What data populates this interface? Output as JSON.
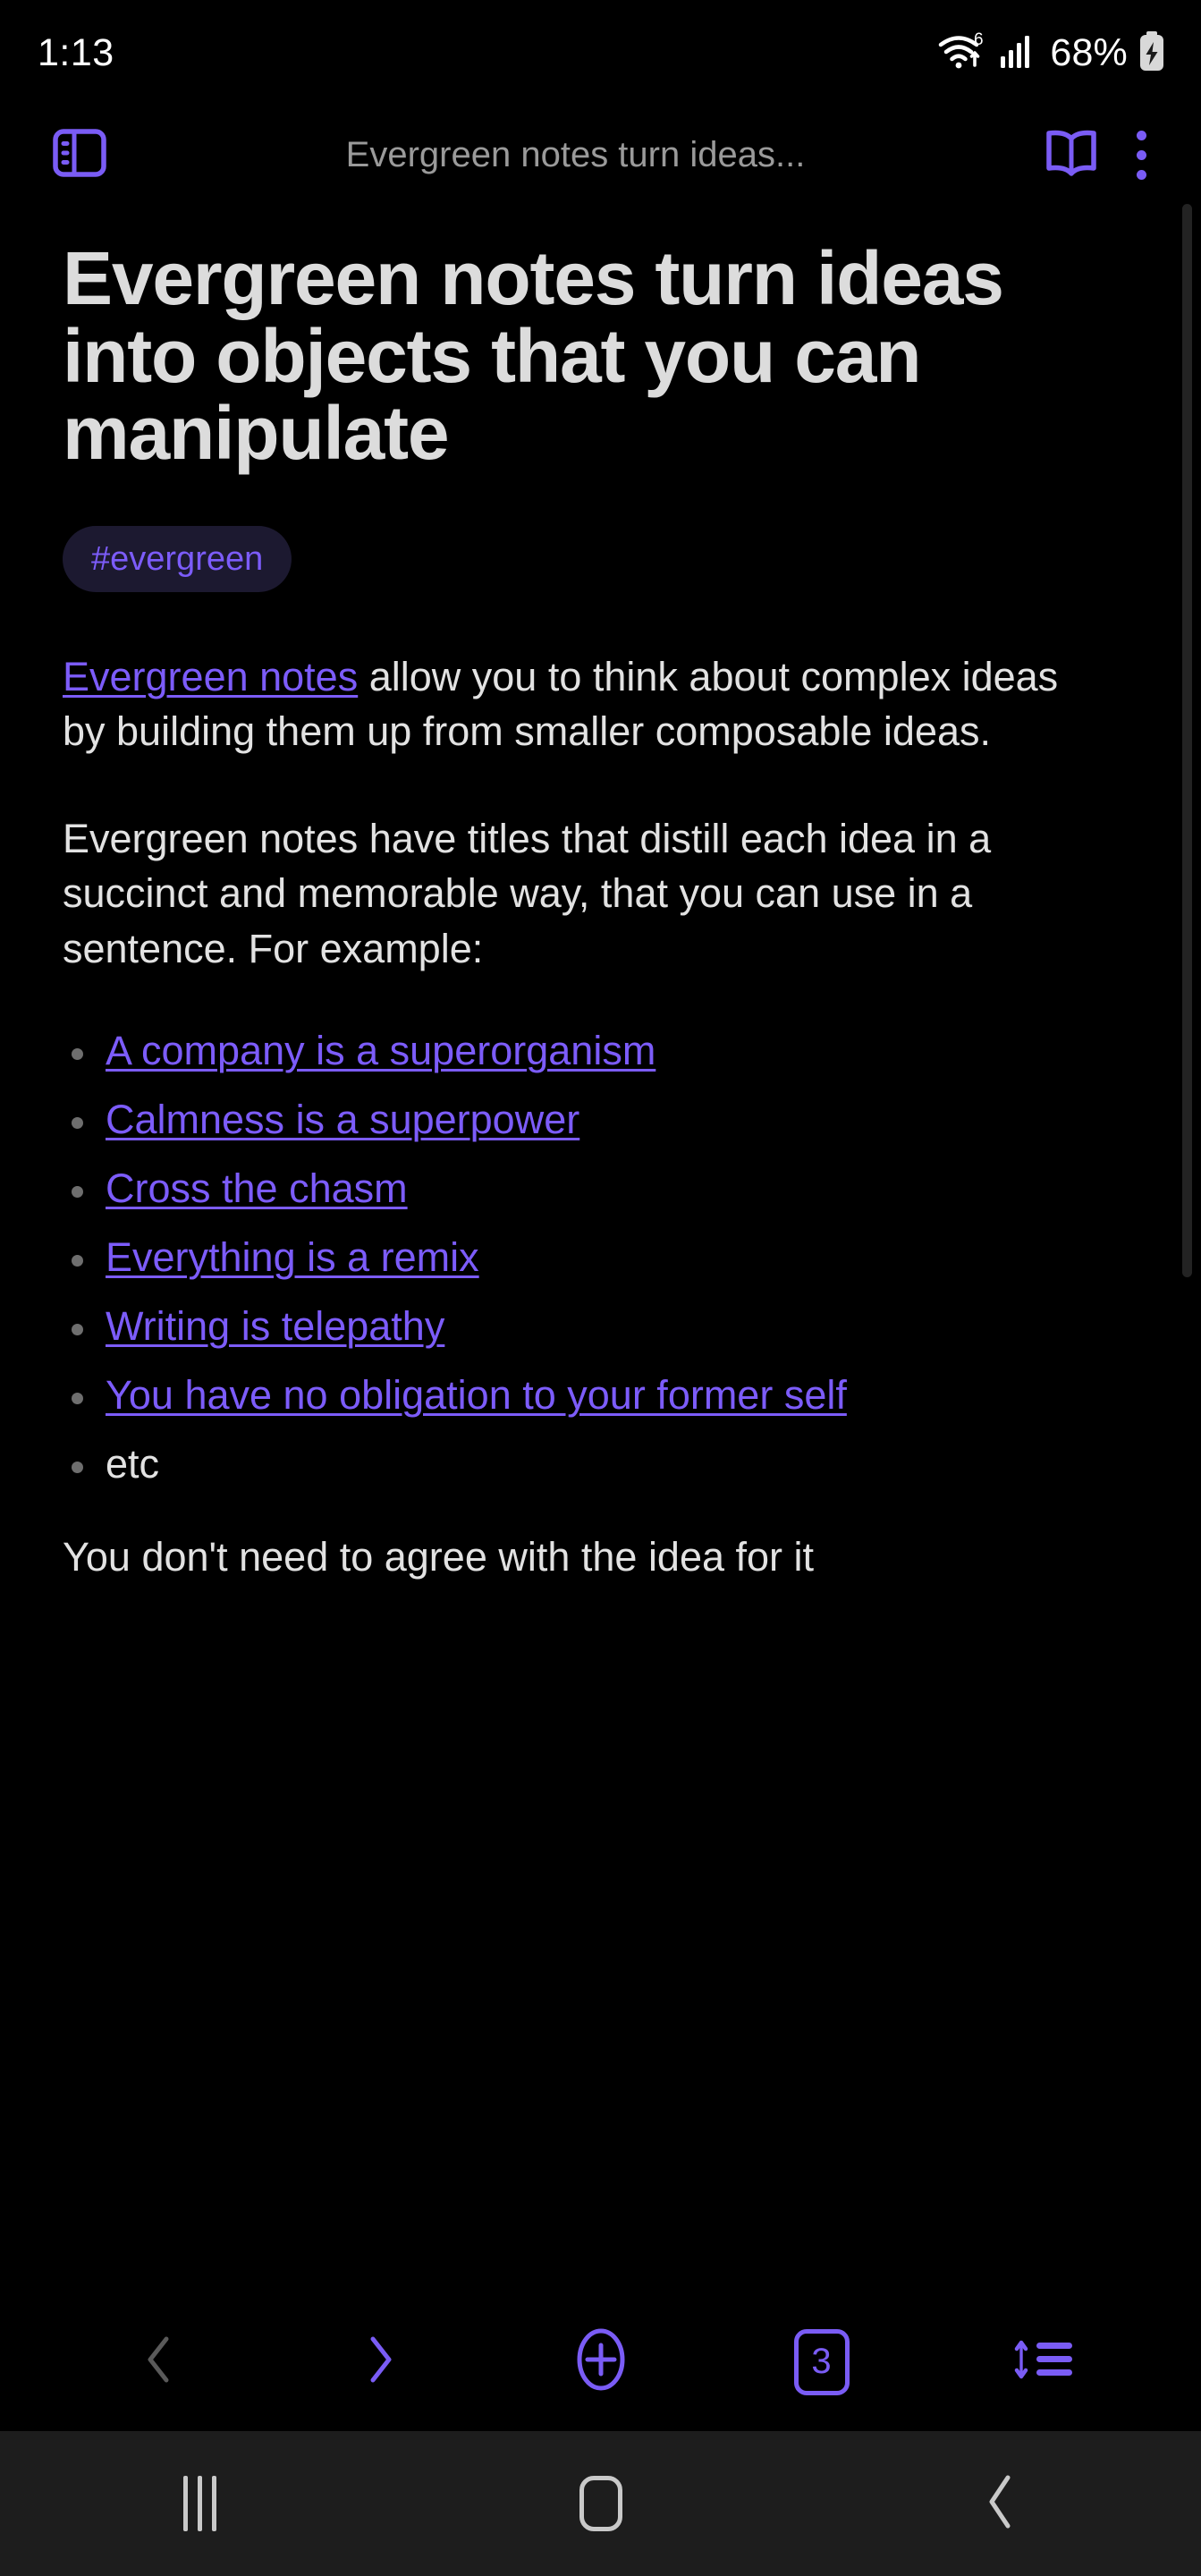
{
  "status_bar": {
    "time": "1:13",
    "wifi_icon": "wifi-6-icon",
    "wifi_generation": "6",
    "cellular_icon": "cellular-signal-icon",
    "battery_percent": "68%",
    "battery_icon": "battery-charging-icon"
  },
  "app_bar": {
    "sidebar_toggle_icon": "sidebar-panel-icon",
    "title": "Evergreen notes turn ideas...",
    "reader_icon": "open-book-icon",
    "overflow_icon": "kebab-menu-icon"
  },
  "note": {
    "title": "Evergreen notes turn ideas into objects that you can manipulate",
    "tag": "#evergreen",
    "paragraph_1_link": "Evergreen notes",
    "paragraph_1_rest": " allow you to think about complex ideas by building them up from smaller composable ideas.",
    "paragraph_2": "Evergreen notes have titles that distill each idea in a succinct and memorable way, that you can use in a sentence. For example:",
    "examples": [
      {
        "text": "A company is a superorganism",
        "is_link": true
      },
      {
        "text": "Calmness is a superpower",
        "is_link": true
      },
      {
        "text": "Cross the chasm",
        "is_link": true
      },
      {
        "text": "Everything is a remix",
        "is_link": true
      },
      {
        "text": "Writing is telepathy",
        "is_link": true
      },
      {
        "text": "You have no obligation to your former self",
        "is_link": true
      },
      {
        "text": "etc",
        "is_link": false
      }
    ],
    "paragraph_3_partial": "You don't need to agree with the idea for it"
  },
  "browser_toolbar": {
    "back_icon": "chevron-left-icon",
    "forward_icon": "chevron-right-icon",
    "new_tab_icon": "plus-circle-icon",
    "tab_count": "3",
    "menu_icon": "sort-list-icon"
  },
  "android_nav": {
    "recents_icon": "recents-icon",
    "home_icon": "home-icon",
    "back_icon": "back-chevron-icon"
  },
  "colors": {
    "background": "#000000",
    "accent_purple": "#7a5cf5",
    "link_purple": "#7c5cfa",
    "tag_background": "#1c1930",
    "body_text": "#e2e2e2",
    "title_text": "#dcdcdc",
    "appbar_title_text": "#9a9a9a",
    "disabled_icon": "#5a5a5a",
    "navbar_background": "#1d1d1d"
  }
}
